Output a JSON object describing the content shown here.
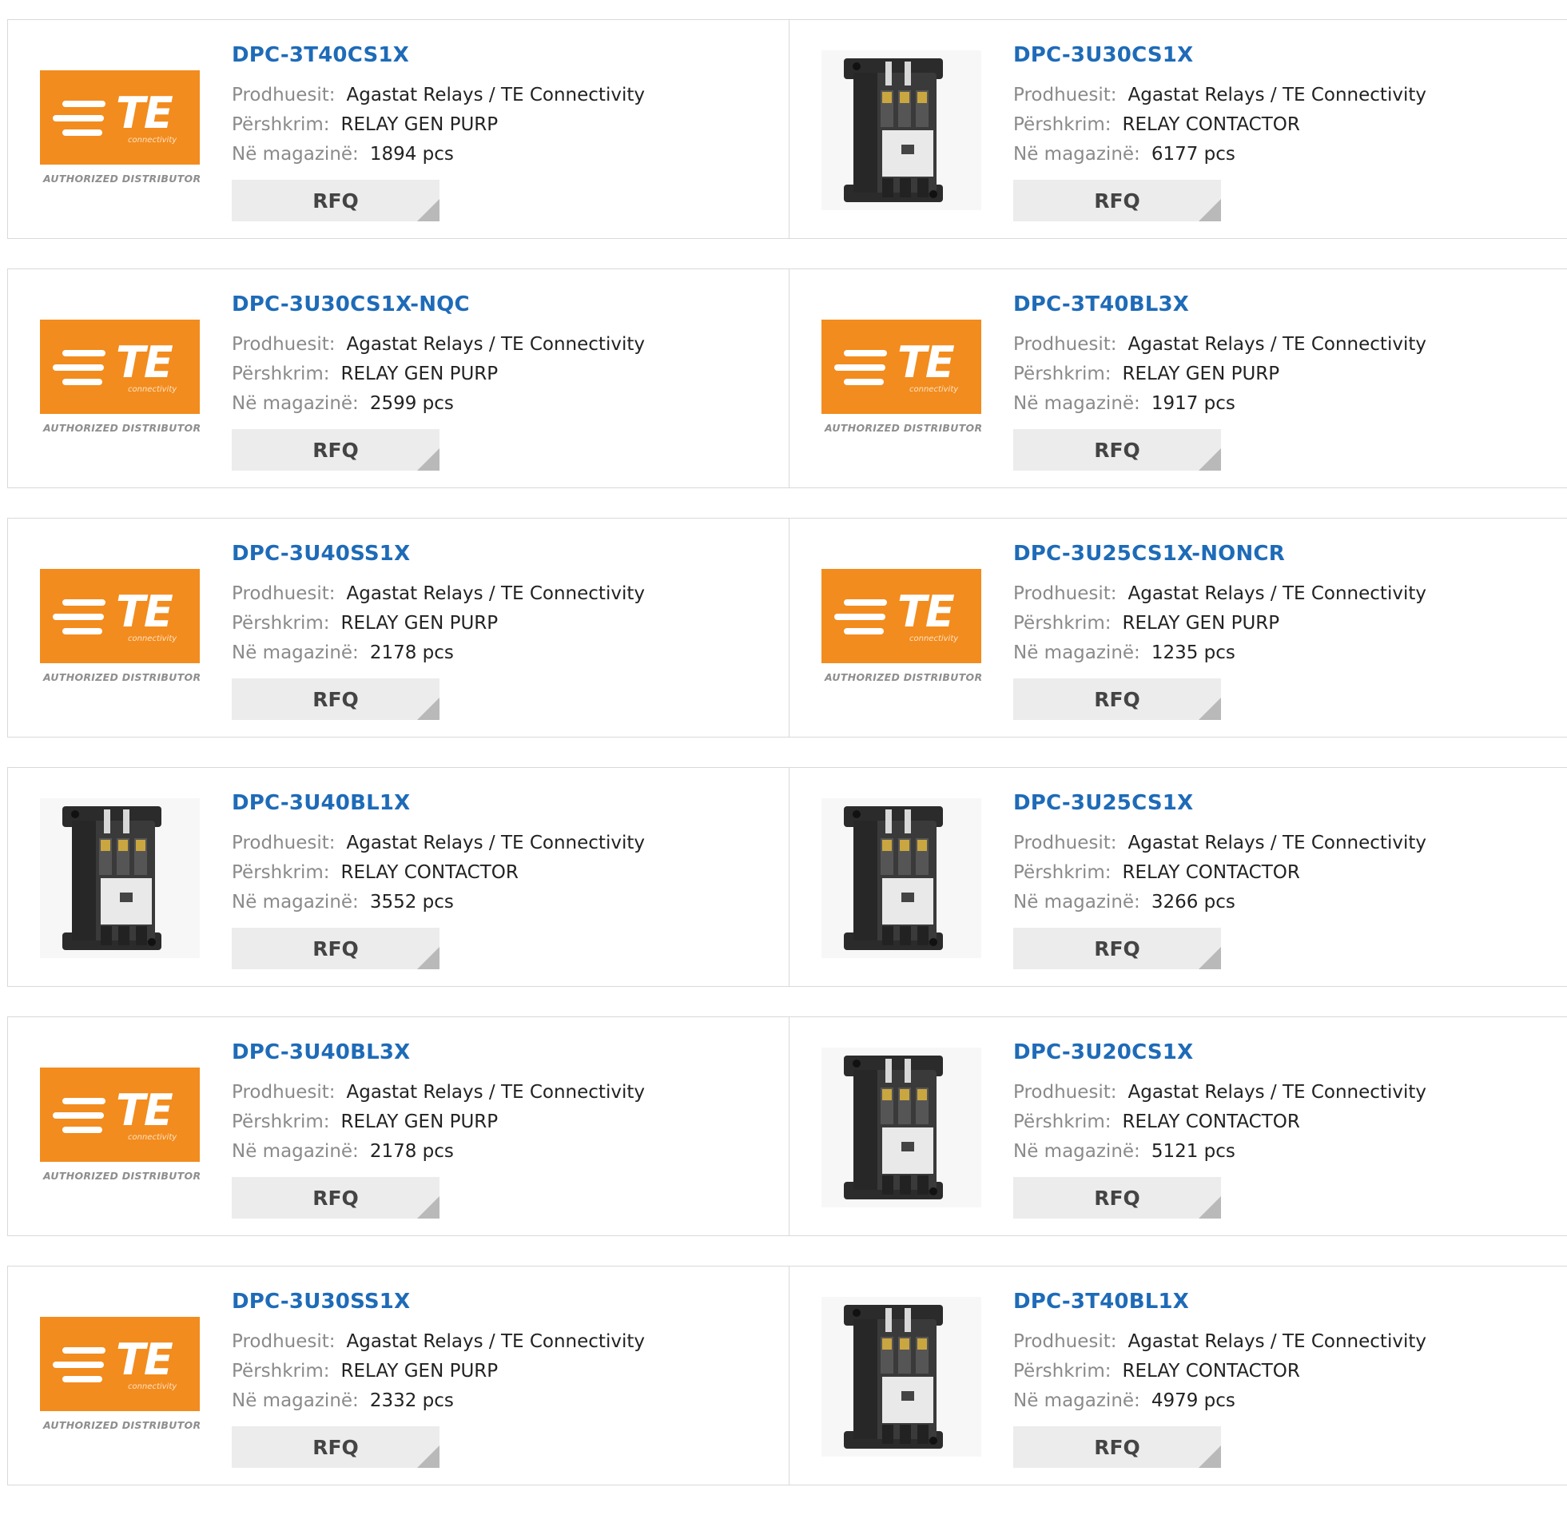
{
  "labels": {
    "manufacturer": "Prodhuesit:",
    "description": "Përshkrim:",
    "stock": "Në magazinë:",
    "rfq": "RFQ",
    "logo_brand": "TE",
    "logo_sub": "connectivity",
    "logo_authorized": "AUTHORIZED DISTRIBUTOR"
  },
  "colors": {
    "logo_orange": "#f28c1e",
    "link_blue": "#1e6bb8"
  },
  "products": [
    {
      "part": "DPC-3T40CS1X",
      "manufacturer": "Agastat Relays / TE Connectivity",
      "description": "RELAY GEN PURP",
      "stock": "1894 pcs",
      "image": "te-logo"
    },
    {
      "part": "DPC-3U30CS1X",
      "manufacturer": "Agastat Relays / TE Connectivity",
      "description": "RELAY CONTACTOR",
      "stock": "6177 pcs",
      "image": "contactor-photo"
    },
    {
      "part": "DPC-3U30CS1X-NQC",
      "manufacturer": "Agastat Relays / TE Connectivity",
      "description": "RELAY GEN PURP",
      "stock": "2599 pcs",
      "image": "te-logo"
    },
    {
      "part": "DPC-3T40BL3X",
      "manufacturer": "Agastat Relays / TE Connectivity",
      "description": "RELAY GEN PURP",
      "stock": "1917 pcs",
      "image": "te-logo"
    },
    {
      "part": "DPC-3U40SS1X",
      "manufacturer": "Agastat Relays / TE Connectivity",
      "description": "RELAY GEN PURP",
      "stock": "2178 pcs",
      "image": "te-logo"
    },
    {
      "part": "DPC-3U25CS1X-NONCR",
      "manufacturer": "Agastat Relays / TE Connectivity",
      "description": "RELAY GEN PURP",
      "stock": "1235 pcs",
      "image": "te-logo"
    },
    {
      "part": "DPC-3U40BL1X",
      "manufacturer": "Agastat Relays / TE Connectivity",
      "description": "RELAY CONTACTOR",
      "stock": "3552 pcs",
      "image": "contactor-photo"
    },
    {
      "part": "DPC-3U25CS1X",
      "manufacturer": "Agastat Relays / TE Connectivity",
      "description": "RELAY CONTACTOR",
      "stock": "3266 pcs",
      "image": "contactor-photo"
    },
    {
      "part": "DPC-3U40BL3X",
      "manufacturer": "Agastat Relays / TE Connectivity",
      "description": "RELAY GEN PURP",
      "stock": "2178 pcs",
      "image": "te-logo"
    },
    {
      "part": "DPC-3U20CS1X",
      "manufacturer": "Agastat Relays / TE Connectivity",
      "description": "RELAY CONTACTOR",
      "stock": "5121 pcs",
      "image": "contactor-photo"
    },
    {
      "part": "DPC-3U30SS1X",
      "manufacturer": "Agastat Relays / TE Connectivity",
      "description": "RELAY GEN PURP",
      "stock": "2332 pcs",
      "image": "te-logo"
    },
    {
      "part": "DPC-3T40BL1X",
      "manufacturer": "Agastat Relays / TE Connectivity",
      "description": "RELAY CONTACTOR",
      "stock": "4979 pcs",
      "image": "contactor-photo"
    }
  ]
}
